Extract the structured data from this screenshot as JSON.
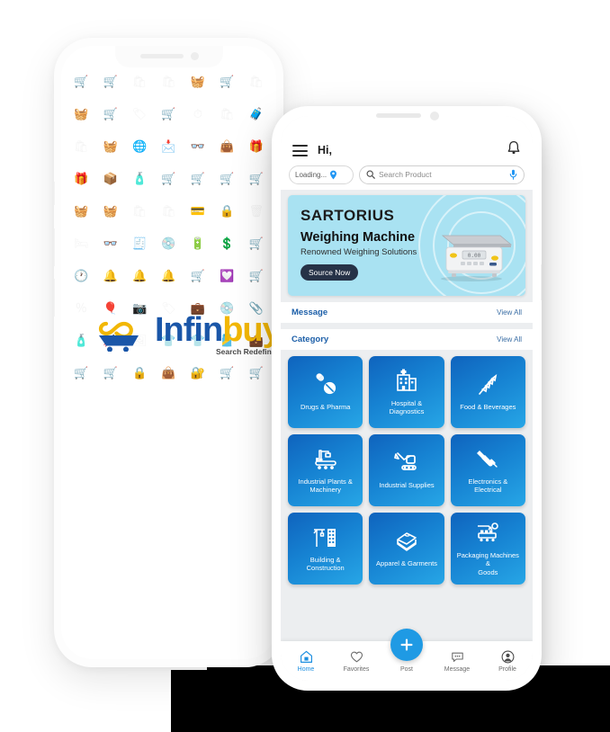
{
  "brand": {
    "name_part1": "Infin",
    "name_part2": "buy",
    "tagline": "Search Redefined",
    "logo_icon": "infinity-cart-icon",
    "color_primary": "#1a56a8",
    "color_accent": "#f2b705"
  },
  "app": {
    "header": {
      "menu_icon": "hamburger-menu-icon",
      "greeting": "Hi,",
      "notification_icon": "bell-icon"
    },
    "search": {
      "location_label": "Loading...",
      "location_icon": "location-pin-icon",
      "search_icon": "search-icon",
      "placeholder": "Search Product",
      "value": "",
      "mic_icon": "microphone-icon",
      "mic_color": "#2196f3"
    },
    "banner": {
      "brand_logo": "SARTORIUS",
      "headline": "Weighing Machine",
      "subtitle": "Renowned Weighing Solutions",
      "cta_label": "Source Now",
      "product_image": "weighing-scale-image",
      "background_color": "#a9e2f2",
      "cta_color": "#263247"
    },
    "sections": [
      {
        "title": "Message",
        "view_all": "View All"
      },
      {
        "title": "Category",
        "view_all": "View All"
      }
    ],
    "categories": [
      {
        "label": "Drugs & Pharma",
        "icon": "pills-capsule-icon"
      },
      {
        "label": "Hospital & Diagnostics",
        "icon": "hospital-building-icon"
      },
      {
        "label": "Food & Beverages",
        "icon": "wheat-grain-icon"
      },
      {
        "label": "Industrial Plants &\nMachinery",
        "icon": "factory-conveyor-icon"
      },
      {
        "label": "Industrial Supplies",
        "icon": "excavator-icon"
      },
      {
        "label": "Electronics & Electrical",
        "icon": "power-drill-icon"
      },
      {
        "label": "Building & Construction",
        "icon": "crane-building-icon"
      },
      {
        "label": "Apparel & Garments",
        "icon": "folded-clothes-icon"
      },
      {
        "label": "Packaging Machines &\nGoods",
        "icon": "packaging-machine-icon"
      }
    ],
    "tile_gradient_from": "#0f63bd",
    "tile_gradient_to": "#27a6e6",
    "bottom_nav": {
      "items": [
        {
          "label": "Home",
          "icon": "home-icon",
          "active": true
        },
        {
          "label": "Favorites",
          "icon": "heart-icon",
          "active": false
        },
        {
          "label": "Post",
          "icon": "plus-icon",
          "active": false
        },
        {
          "label": "Message",
          "icon": "chat-bubble-icon",
          "active": false
        },
        {
          "label": "Profile",
          "icon": "user-avatar-icon",
          "active": false
        }
      ],
      "fab_icon": "plus-icon",
      "fab_color": "#1f9ae4",
      "active_color": "#1d8fe0"
    }
  },
  "watermark": {
    "icons": [
      "🛒",
      "🛒",
      "🛍",
      "🛍",
      "🧺",
      "🛒",
      "🛍",
      "🧺",
      "🛒",
      "🏷",
      "🛒",
      "⏱",
      "🛍",
      "🧳",
      "🛍",
      "🧺",
      "🌐",
      "📩",
      "👓",
      "👜",
      "🎁",
      "🎁",
      "📦",
      "🧴",
      "🛒",
      "🛒",
      "🛒",
      "🛒",
      "🧺",
      "🧺",
      "🛍",
      "🛍",
      "💳",
      "🔒",
      "🗑",
      "🛏",
      "👓",
      "🧾",
      "💿",
      "🔋",
      "💲",
      "🛒",
      "🕐",
      "🔔",
      "🔔",
      "🔔",
      "🛒",
      "💟",
      "🛒",
      "％",
      "🎈",
      "📷",
      "🏷",
      "💼",
      "💿",
      "📎",
      "🧴",
      "🥢",
      "🖼",
      "👕",
      "👕",
      "🎽",
      "💼",
      "🛒",
      "🛒",
      "🔒",
      "👜",
      "🔐",
      "🛒",
      "🛒"
    ]
  }
}
